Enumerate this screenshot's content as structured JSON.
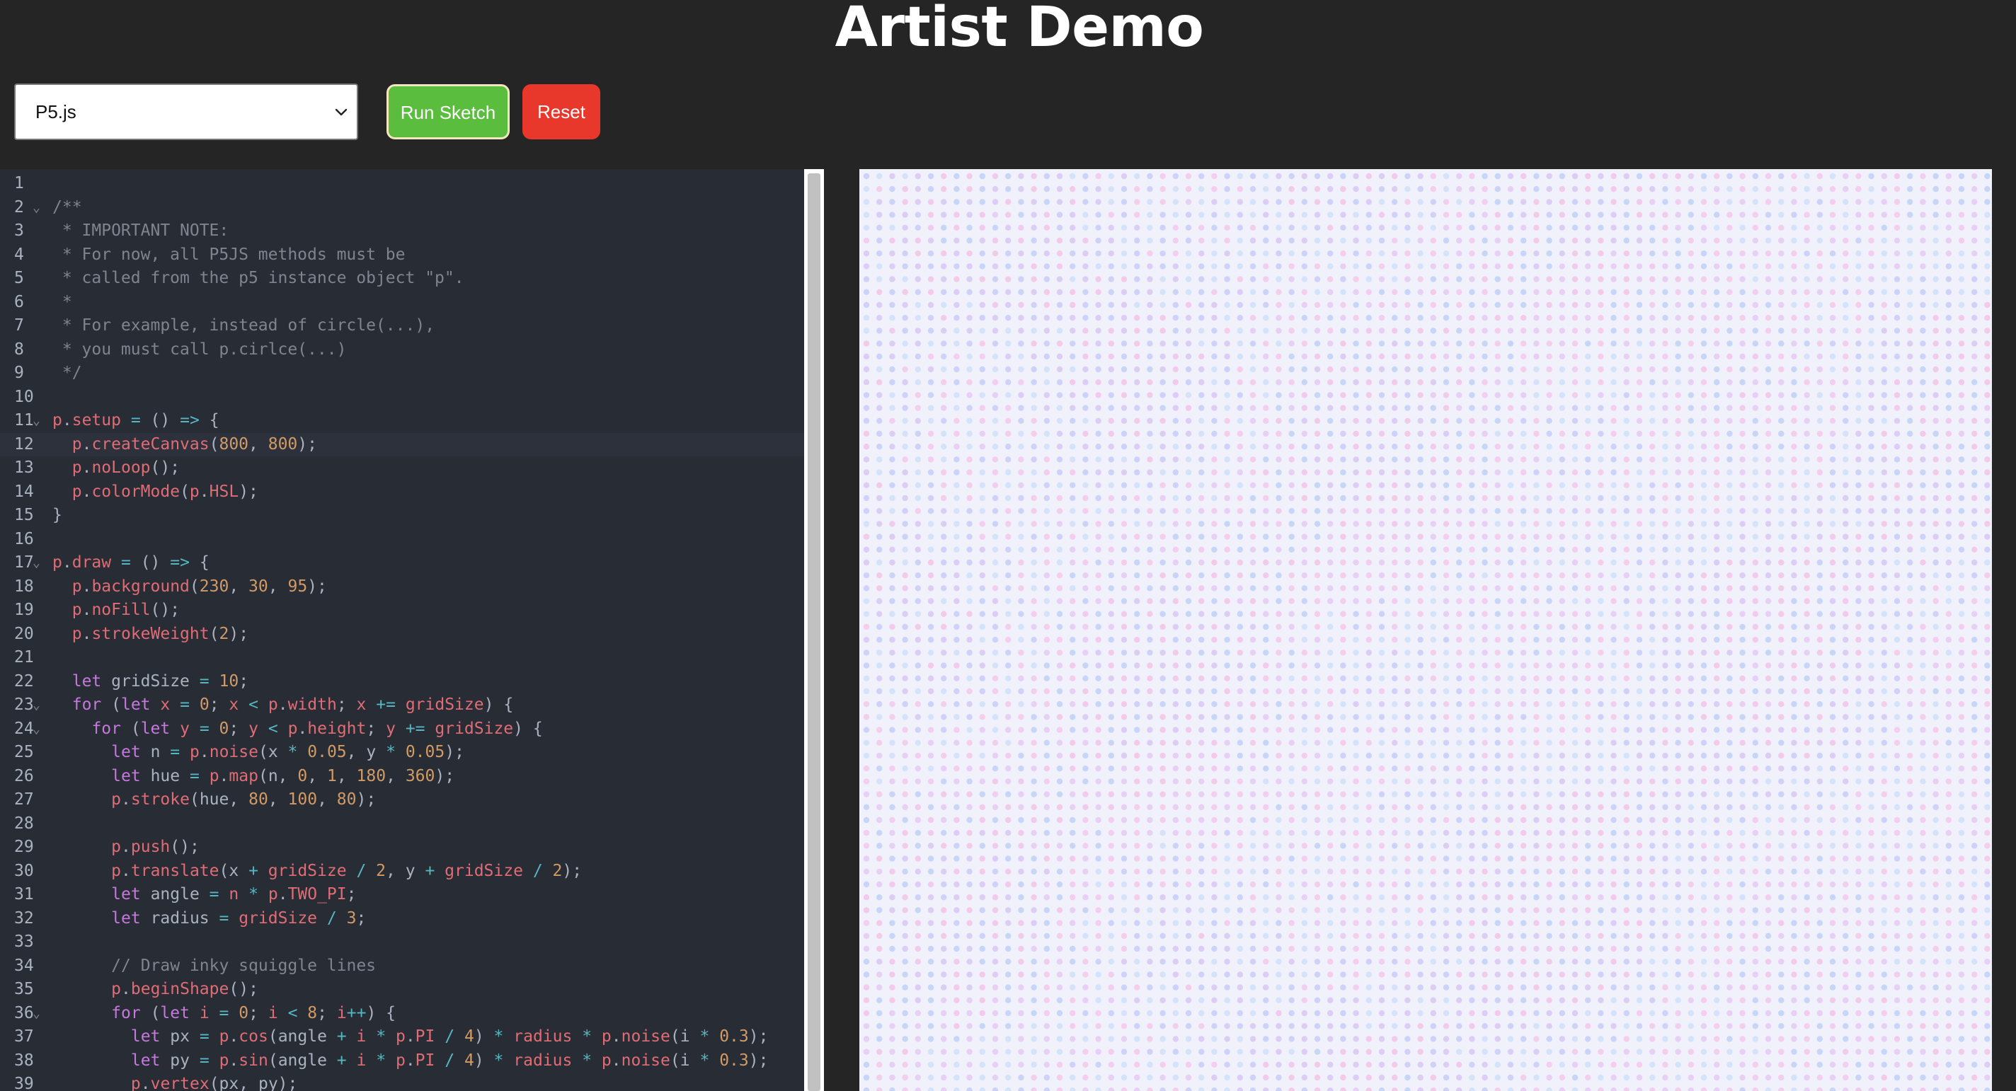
{
  "header": {
    "title": "Artist Demo"
  },
  "toolbar": {
    "library_select": {
      "value": "P5.js"
    },
    "run_label": "Run Sketch",
    "reset_label": "Reset"
  },
  "colors": {
    "background": "#252526",
    "editor_background": "#282c34",
    "run_button": "#5bbd3d",
    "reset_button": "#e8382b",
    "comment": "#7f848e",
    "keyword": "#c678dd",
    "property": "#e06c75",
    "number": "#d19a66",
    "operator": "#56b6c2",
    "plain": "#abb2bf",
    "canvas_background": "#f0f1fa"
  },
  "editor": {
    "active_line": 12,
    "folded_lines": [
      2,
      11,
      17,
      23,
      24,
      36
    ],
    "lines": [
      "",
      "/**",
      " * IMPORTANT NOTE:",
      " * For now, all P5JS methods must be",
      " * called from the p5 instance object \"p\".",
      " *",
      " * For example, instead of circle(...),",
      " * you must call p.cirlce(...)",
      " */",
      "",
      "p.setup = () => {",
      "  p.createCanvas(800, 800);",
      "  p.noLoop();",
      "  p.colorMode(p.HSL);",
      "}",
      "",
      "p.draw = () => {",
      "  p.background(230, 30, 95);",
      "  p.noFill();",
      "  p.strokeWeight(2);",
      "",
      "  let gridSize = 10;",
      "  for (let x = 0; x < p.width; x += gridSize) {",
      "    for (let y = 0; y < p.height; y += gridSize) {",
      "      let n = p.noise(x * 0.05, y * 0.05);",
      "      let hue = p.map(n, 0, 1, 180, 360);",
      "      p.stroke(hue, 80, 100, 80);",
      "",
      "      p.push();",
      "      p.translate(x + gridSize / 2, y + gridSize / 2);",
      "      let angle = n * p.TWO_PI;",
      "      let radius = gridSize / 3;",
      "",
      "      // Draw inky squiggle lines",
      "      p.beginShape();",
      "      for (let i = 0; i < 8; i++) {",
      "        let px = p.cos(angle + i * p.PI / 4) * radius * p.noise(i * 0.3);",
      "        let py = p.sin(angle + i * p.PI / 4) * radius * p.noise(i * 0.3);",
      "        p.vertex(px, py);"
    ]
  },
  "sketch_canvas": {
    "dot_colors": [
      "#c9ccf7",
      "#d8c7f3",
      "#f3c4e6",
      "#bfd0f5",
      "#e6c9f2",
      "#f5c8ea",
      "#cfe0f8"
    ]
  }
}
